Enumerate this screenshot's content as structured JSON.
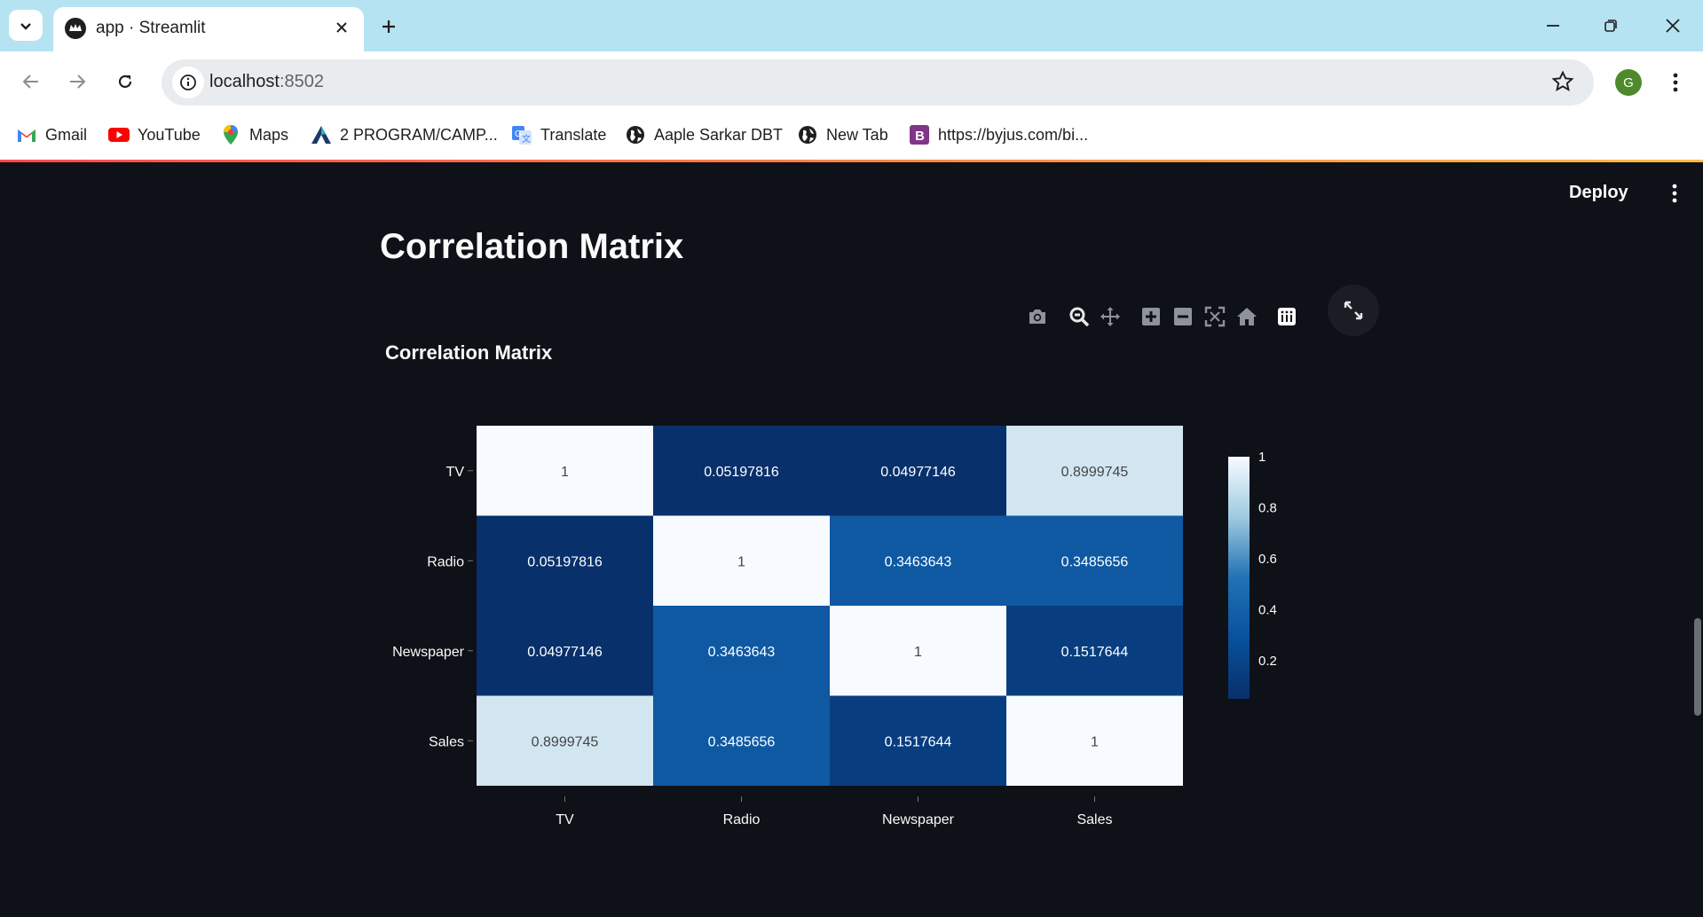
{
  "browser": {
    "tab_title": "app · Streamlit",
    "url_host": "localhost",
    "url_port": ":8502",
    "profile_initial": "G",
    "bookmarks": [
      {
        "label": "Gmail",
        "icon": "gmail-icon"
      },
      {
        "label": "YouTube",
        "icon": "youtube-icon"
      },
      {
        "label": "Maps",
        "icon": "maps-icon"
      },
      {
        "label": "2 PROGRAM/CAMP...",
        "icon": "a-logo-icon"
      },
      {
        "label": "Translate",
        "icon": "translate-icon"
      },
      {
        "label": "Aaple Sarkar DBT",
        "icon": "globe-icon"
      },
      {
        "label": "New Tab",
        "icon": "globe-icon"
      },
      {
        "label": "https://byjus.com/bi...",
        "icon": "byjus-icon"
      }
    ]
  },
  "app": {
    "deploy_label": "Deploy",
    "page_title": "Correlation Matrix"
  },
  "chart_data": {
    "type": "heatmap",
    "title": "Correlation Matrix",
    "x_categories": [
      "TV",
      "Radio",
      "Newspaper",
      "Sales"
    ],
    "y_categories": [
      "TV",
      "Radio",
      "Newspaper",
      "Sales"
    ],
    "z": [
      [
        1,
        0.05197816,
        0.04977146,
        0.8999745
      ],
      [
        0.05197816,
        1,
        0.3463643,
        0.3485656
      ],
      [
        0.04977146,
        0.3463643,
        1,
        0.1517644
      ],
      [
        0.8999745,
        0.3485656,
        0.1517644,
        1
      ]
    ],
    "colorscale": "Blues",
    "colorbar_ticks": [
      "1",
      "0.8",
      "0.6",
      "0.4",
      "0.2"
    ],
    "colorbar_tick_values": [
      1,
      0.8,
      0.6,
      0.4,
      0.2
    ],
    "zmin": 0.04977146,
    "zmax": 1
  }
}
